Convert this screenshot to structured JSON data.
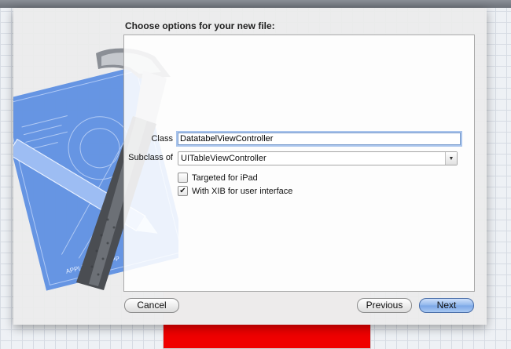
{
  "dialog": {
    "title": "Choose options for your new file:",
    "class_label": "Class",
    "class_value": "DatatabelViewController",
    "subclass_label": "Subclass of",
    "subclass_value": "UITableViewController",
    "ipad_label": "Targeted for iPad",
    "ipad_checked": false,
    "xib_label": "With XIB for user interface",
    "xib_checked": true,
    "xib_check_glyph": "✔",
    "cancel_label": "Cancel",
    "previous_label": "Previous",
    "next_label": "Next"
  },
  "artwork": {
    "blueprint_text": "APPLICATION APP"
  },
  "icons": {
    "dropdown_arrow": "▼",
    "blueprint": "blueprint-icon",
    "hammer": "hammer-icon"
  },
  "colors": {
    "accent": "#7aa7e6",
    "blueprint": "#4a7fd8",
    "background_red": "#f00000"
  }
}
